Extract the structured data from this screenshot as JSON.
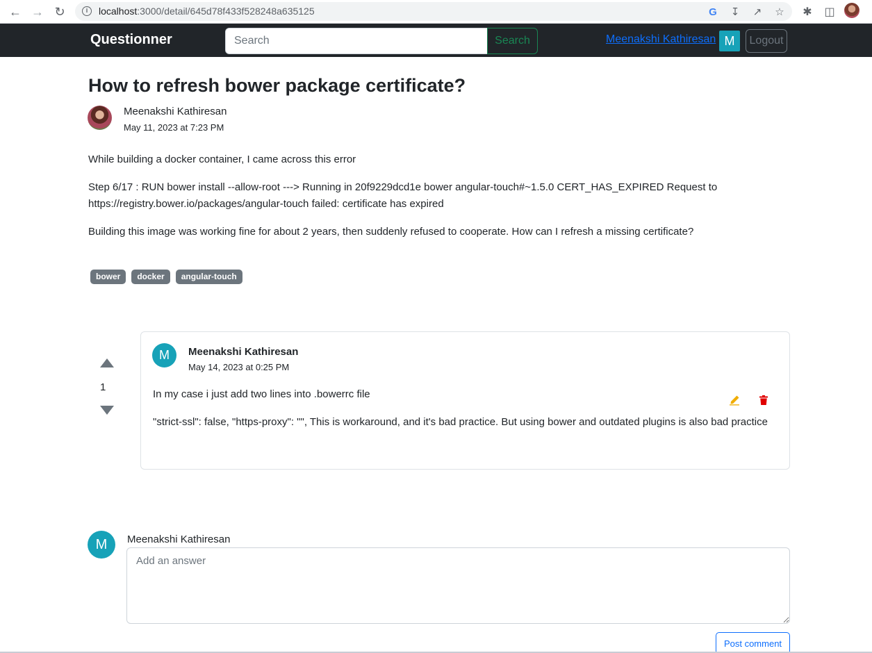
{
  "browser": {
    "url_host": "localhost",
    "url_path": ":3000/detail/645d78f433f528248a635125"
  },
  "navbar": {
    "brand": "Questionner",
    "search_placeholder": "Search",
    "search_button": "Search",
    "user_name": "Meenakshi Kathiresan",
    "user_initial": "M",
    "logout_label": "Logout"
  },
  "question": {
    "title": "How to refresh bower package certificate?",
    "author": "Meenakshi Kathiresan",
    "date": "May 11, 2023 at 7:23 PM",
    "body": [
      "While building a docker container, I came across this error",
      "Step 6/17 : RUN bower install --allow-root ---> Running in 20f9229dcd1e bower angular-touch#~1.5.0 CERT_HAS_EXPIRED Request to https://registry.bower.io/packages/angular-touch failed: certificate has expired",
      "Building this image was working fine for about 2 years, then suddenly refused to cooperate. How can I refresh a missing certificate?"
    ],
    "tags": [
      "bower",
      "docker",
      "angular-touch"
    ]
  },
  "answer": {
    "votes": "1",
    "author_initial": "M",
    "author": "Meenakshi Kathiresan",
    "date": "May 14, 2023 at 0:25 PM",
    "body": [
      "In my case i just add two lines into .bowerrc file",
      "\"strict-ssl\": false, \"https-proxy\": \"\", This is workaround, and it's bad practice. But using bower and outdated plugins is also bad practice"
    ]
  },
  "comment_form": {
    "author_initial": "M",
    "author": "Meenakshi Kathiresan",
    "placeholder": "Add an answer",
    "submit_label": "Post comment"
  },
  "colors": {
    "navbar_bg": "#212529",
    "avatar_bg": "#17a2b8",
    "search_button": "#198754",
    "link": "#0d6efd",
    "tag_bg": "#6c757d",
    "edit_icon": "#f0ad00",
    "delete_icon": "#e00000"
  }
}
